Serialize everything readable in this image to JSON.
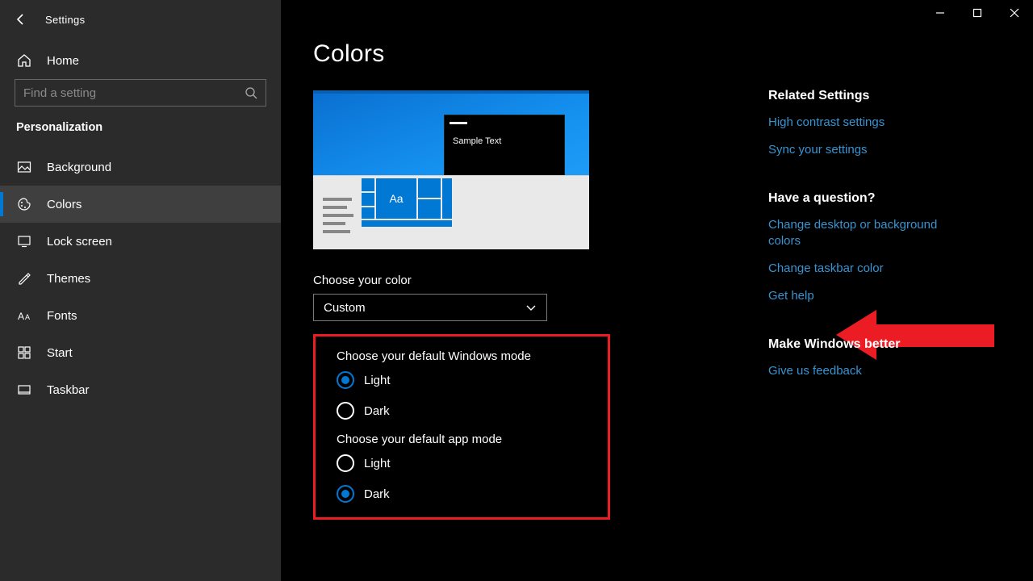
{
  "window": {
    "app_title": "Settings"
  },
  "sidebar": {
    "home_label": "Home",
    "search_placeholder": "Find a setting",
    "category": "Personalization",
    "items": [
      {
        "label": "Background"
      },
      {
        "label": "Colors"
      },
      {
        "label": "Lock screen"
      },
      {
        "label": "Themes"
      },
      {
        "label": "Fonts"
      },
      {
        "label": "Start"
      },
      {
        "label": "Taskbar"
      }
    ]
  },
  "main": {
    "page_title": "Colors",
    "preview": {
      "tile_text": "Aa",
      "window_text": "Sample Text"
    },
    "choose_color": {
      "label": "Choose your color",
      "value": "Custom"
    },
    "windows_mode": {
      "label": "Choose your default Windows mode",
      "options": [
        "Light",
        "Dark"
      ],
      "selected": "Light"
    },
    "app_mode": {
      "label": "Choose your default app mode",
      "options": [
        "Light",
        "Dark"
      ],
      "selected": "Dark"
    }
  },
  "right": {
    "related": {
      "heading": "Related Settings",
      "links": [
        "High contrast settings",
        "Sync your settings"
      ]
    },
    "question": {
      "heading": "Have a question?",
      "links": [
        "Change desktop or background colors",
        "Change taskbar color",
        "Get help"
      ]
    },
    "better": {
      "heading": "Make Windows better",
      "links": [
        "Give us feedback"
      ]
    }
  }
}
